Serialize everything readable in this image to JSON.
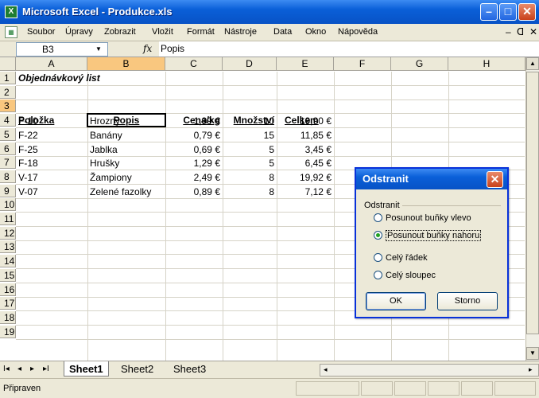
{
  "window": {
    "title": "Microsoft Excel - Produkce.xls",
    "app_icon": "X",
    "minimize": "–",
    "restore": "□",
    "close": "✕"
  },
  "menu": {
    "items": [
      "Soubor",
      "Úpravy",
      "Zobrazit",
      "Vložit",
      "Formát",
      "Nástroje",
      "Data",
      "Okno",
      "Nápověda"
    ],
    "minimize": "–",
    "restore": "ᗡ",
    "close": "✕"
  },
  "formula_bar": {
    "name_box": "B3",
    "fx": "fx",
    "formula": "Popis"
  },
  "columns": [
    "A",
    "B",
    "C",
    "D",
    "E",
    "F",
    "G",
    "H"
  ],
  "active_column": "B",
  "rows": [
    "1",
    "2",
    "3",
    "4",
    "5",
    "6",
    "7",
    "8",
    "9",
    "10",
    "11",
    "12",
    "13",
    "14",
    "15",
    "16",
    "17",
    "18",
    "19"
  ],
  "active_row": "3",
  "sheet": {
    "title": "Objednávkový list",
    "headers": [
      "Položka",
      "Popis",
      "Cena/kg",
      "Množství",
      "Celkem"
    ],
    "data": [
      [
        "F-10",
        "Hrozny",
        "1,99 €",
        "10",
        "19,90 €"
      ],
      [
        "F-22",
        "Banány",
        "0,79 €",
        "15",
        "11,85 €"
      ],
      [
        "F-25",
        "Jablka",
        "0,69 €",
        "5",
        "3,45 €"
      ],
      [
        "F-18",
        "Hrušky",
        "1,29 €",
        "5",
        "6,45 €"
      ],
      [
        "V-17",
        "Žampiony",
        "2,49 €",
        "8",
        "19,92 €"
      ],
      [
        "V-07",
        "Zelené fazolky",
        "0,89 €",
        "8",
        "7,12 €"
      ]
    ]
  },
  "tabs": {
    "nav": [
      "I◂",
      "◂",
      "▸",
      "▸I"
    ],
    "sheets": [
      "Sheet1",
      "Sheet2",
      "Sheet3"
    ],
    "active": "Sheet1"
  },
  "status": {
    "text": "Připraven"
  },
  "dialog": {
    "title": "Odstranit",
    "close": "✕",
    "group_label": "Odstranit",
    "options": [
      "Posunout buňky vlevo",
      "Posunout buňky nahoru",
      "Celý řádek",
      "Celý sloupec"
    ],
    "selected_index": 1,
    "ok": "OK",
    "cancel": "Storno"
  }
}
